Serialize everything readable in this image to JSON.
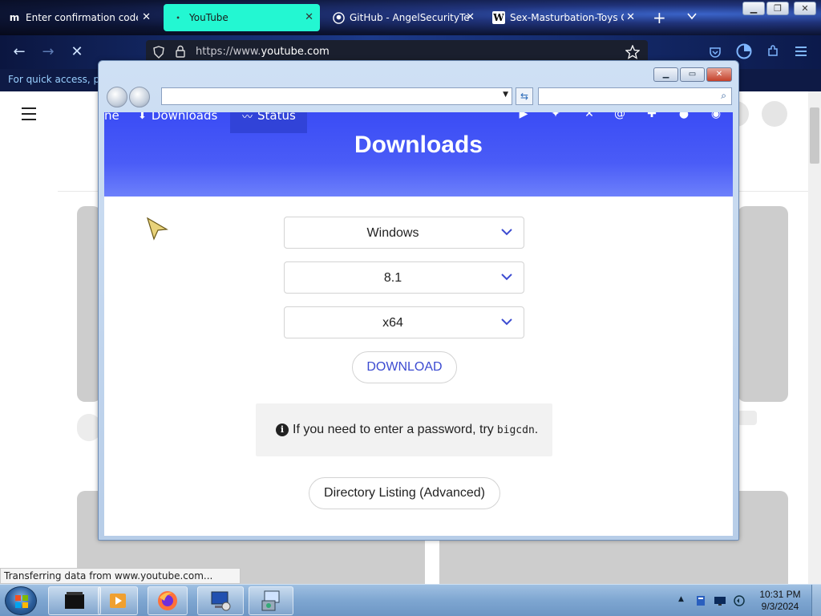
{
  "browser": {
    "tabs": [
      {
        "title": "Enter confirmation code | M",
        "favicon": "m"
      },
      {
        "title": "YouTube",
        "favicon": "•",
        "active": true
      },
      {
        "title": "GitHub - AngelSecurityTea",
        "favicon": "github-icon"
      },
      {
        "title": "Sex-Masturbation-Toys Co",
        "favicon": "W"
      }
    ],
    "new_tab": "+",
    "url_prefix": "https://www.",
    "url_domain": "youtube.com",
    "bookmarks_hint": "For quick access, plac"
  },
  "popup": {
    "nav": {
      "partial": "ne",
      "downloads": "Downloads",
      "status": "Status"
    },
    "title": "Downloads",
    "os_select": "Windows",
    "version_select": "8.1",
    "arch_select": "x64",
    "download_button": "DOWNLOAD",
    "note_text": "If you need to enter a password, try",
    "note_code": "bigcdn",
    "note_end": ".",
    "dir_button": "Directory Listing (Advanced)"
  },
  "statusbar": "Transferring data from www.youtube.com...",
  "taskbar": {
    "time": "10:31 PM",
    "date": "9/3/2024"
  },
  "colors": {
    "accent_blue": "#3a4cf5",
    "active_tab": "#23f7d2",
    "download_text": "#3c4bd1"
  }
}
